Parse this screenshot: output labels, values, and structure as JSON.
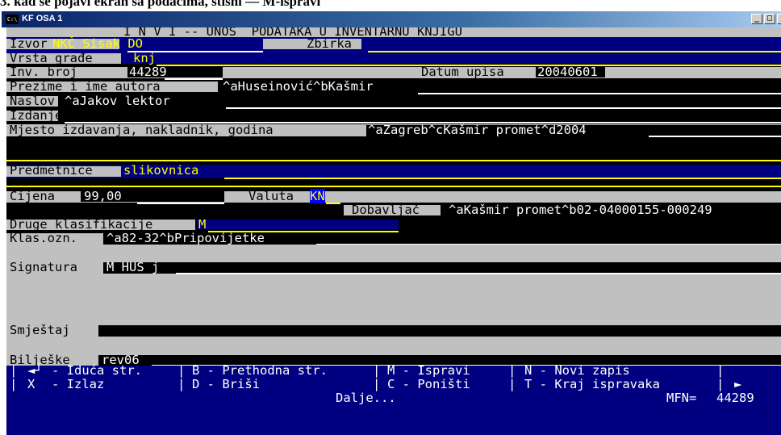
{
  "doc_heading": "3. kad se pojavi ekran sa podacima, stisni — M-ispravi",
  "window": {
    "title": "KF OSA 1",
    "icon_text": "C:\\"
  },
  "header_line": "I N V I -- UNOS  PODATAKA U INVENTARNU KNJIGU",
  "form": {
    "izvor": {
      "label": "Izvor",
      "value": "NKČ Sisak DO"
    },
    "zbirka": {
      "label": "Zbirka",
      "value": ""
    },
    "vrsta": {
      "label": "Vrsta građe",
      "value": "knj"
    },
    "inv_broj": {
      "label": "Inv. broj",
      "value": "44289"
    },
    "datum_upisa": {
      "label": "Datum upisa",
      "value": "20040601"
    },
    "autor": {
      "label": "Prezime i ime autora",
      "value": "^aHuseinović^bKašmir"
    },
    "naslov": {
      "label": "Naslov",
      "value": "^aJakov lektor"
    },
    "izdanje": {
      "label": "Izdanje",
      "value": ""
    },
    "mjesto": {
      "label": "Mjesto izdavanja, nakladnik, godina",
      "value": "^aZagreb^cKašmir promet^d2004"
    },
    "predmetnice": {
      "label": "Predmetnice",
      "value": "slikovnica"
    },
    "cijena": {
      "label": "Cijena",
      "value": "99,00"
    },
    "valuta": {
      "label": "Valuta",
      "value": "KN"
    },
    "dobavljac": {
      "label": "Dobavljač",
      "value": "^aKašmir promet^b02-04000155-000249"
    },
    "druge_klas": {
      "label": "Druge klasifikacije",
      "value": "M"
    },
    "klas_ozn": {
      "label": "Klas.ozn.",
      "value": "^a82-32^bPripovijetke"
    },
    "signatura": {
      "label": "Signatura",
      "value": "M HUS j"
    },
    "smjestaj": {
      "label": "Smještaj",
      "value": ""
    },
    "biljeske": {
      "label": "Bilješke",
      "value": "rev06"
    }
  },
  "footer": {
    "next_key": "◄┘",
    "next": "- Iduća str.",
    "prev": "B - Prethodna str.",
    "edit": "M - Ispravi",
    "new": "N - Novi zapis",
    "exit_key": "X",
    "exit": "- Izlaz",
    "delete": "D - Briši",
    "cancel": "C - Poništi",
    "end_edit": "T - Kraj ispravaka",
    "arrow": "►",
    "more": "Dalje...",
    "mfn_label": "MFN=",
    "mfn_value": "44289"
  }
}
